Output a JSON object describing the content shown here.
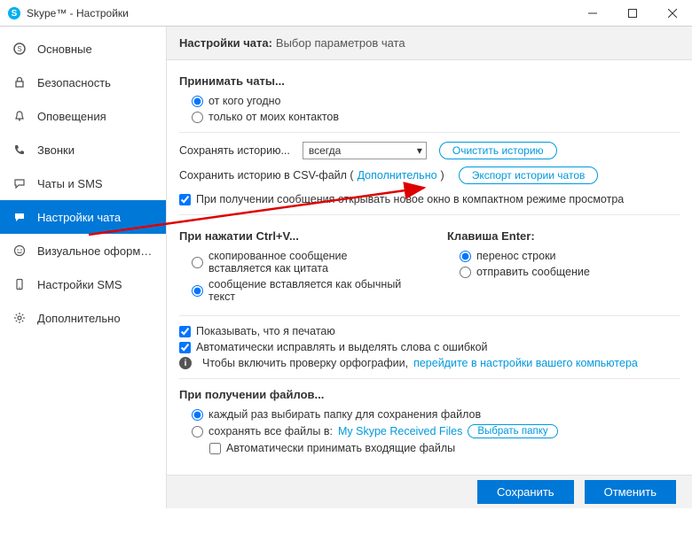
{
  "window": {
    "title": "Skype™ - Настройки"
  },
  "sidebar": {
    "items": [
      {
        "label": "Основные"
      },
      {
        "label": "Безопасность"
      },
      {
        "label": "Оповещения"
      },
      {
        "label": "Звонки"
      },
      {
        "label": "Чаты и SMS"
      },
      {
        "label": "Настройки чата"
      },
      {
        "label": "Визуальное оформле..."
      },
      {
        "label": "Настройки SMS"
      },
      {
        "label": "Дополнительно"
      }
    ]
  },
  "header": {
    "bold": "Настройки чата:",
    "rest": "Выбор параметров чата"
  },
  "accept": {
    "title": "Принимать чаты...",
    "anyone": "от кого угодно",
    "contacts": "только от моих контактов"
  },
  "history": {
    "keep_label": "Сохранять историю...",
    "select_value": "всегда",
    "clear_btn": "Очистить историю",
    "csv_label": "Сохранить историю в CSV-файл (",
    "csv_link": "Дополнительно",
    "csv_close": ")",
    "export_btn": "Экспорт истории чатов",
    "compact_open": "При получении сообщения открывать новое окно в компактном режиме просмотра"
  },
  "ctrlv": {
    "title": "При нажатии Ctrl+V...",
    "as_quote": "скопированное сообщение вставляется как цитата",
    "as_plain": "сообщение вставляется как обычный текст"
  },
  "enter": {
    "title": "Клавиша Enter:",
    "newline": "перенос строки",
    "send": "отправить сообщение"
  },
  "misc": {
    "typing": "Показывать, что я печатаю",
    "autocorrect": "Автоматически исправлять и выделять слова с ошибкой",
    "spell_info": "Чтобы включить проверку орфографии, ",
    "spell_link": "перейдите в настройки вашего компьютера"
  },
  "files": {
    "title": "При получении файлов...",
    "each_time": "каждый раз выбирать папку для сохранения файлов",
    "save_all": "сохранять все файлы в:",
    "folder_link": "My Skype Received Files",
    "choose_btn": "Выбрать папку",
    "auto_accept": "Автоматически принимать входящие файлы"
  },
  "footer": {
    "save": "Сохранить",
    "cancel": "Отменить"
  }
}
